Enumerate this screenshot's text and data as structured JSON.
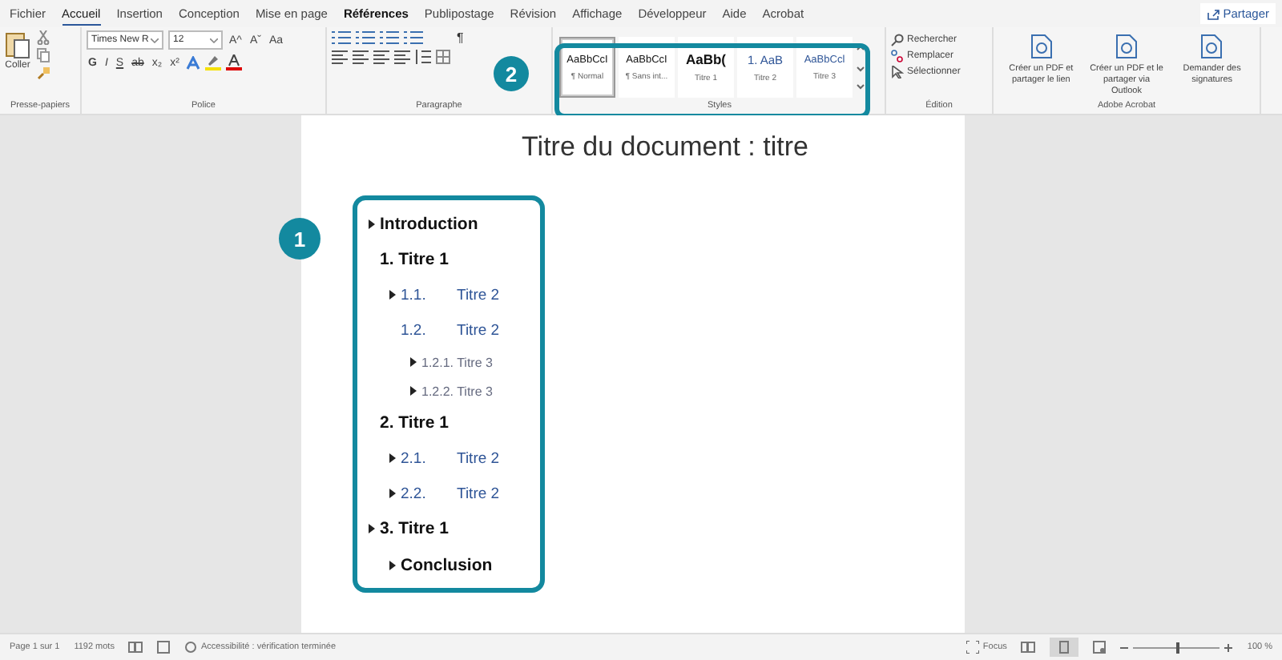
{
  "ribbon_tabs": [
    {
      "label": "Fichier",
      "selected": false,
      "bold": false
    },
    {
      "label": "Accueil",
      "selected": true,
      "bold": false
    },
    {
      "label": "Insertion",
      "selected": false,
      "bold": false
    },
    {
      "label": "Conception",
      "selected": false,
      "bold": false
    },
    {
      "label": "Mise en page",
      "selected": false,
      "bold": false
    },
    {
      "label": "Références",
      "selected": false,
      "bold": true
    },
    {
      "label": "Publipostage",
      "selected": false,
      "bold": false
    },
    {
      "label": "Révision",
      "selected": false,
      "bold": false
    },
    {
      "label": "Affichage",
      "selected": false,
      "bold": false
    },
    {
      "label": "Développeur",
      "selected": false,
      "bold": false
    },
    {
      "label": "Aide",
      "selected": false,
      "bold": false
    },
    {
      "label": "Acrobat",
      "selected": false,
      "bold": false
    }
  ],
  "share_button": "Partager",
  "clipboard": {
    "paste": "Coller",
    "group_label": "Presse-papiers"
  },
  "font": {
    "family": "Times New R",
    "size": "12",
    "grow": "A^",
    "shrink": "Aˇ",
    "case": "Aa",
    "bold": "G",
    "italic": "I",
    "underline": "S",
    "strike": "ab",
    "subscript": "x₂",
    "superscript": "x²",
    "group_label": "Police"
  },
  "paragraph": {
    "group_label": "Paragraphe",
    "pilcrow": "¶"
  },
  "styles": {
    "group_label": "Styles",
    "callout": "2",
    "items": [
      {
        "preview": "AaBbCcI",
        "label": "¶ Normal",
        "kind": "normal",
        "selected": true
      },
      {
        "preview": "AaBbCcI",
        "label": "¶ Sans int...",
        "kind": "plain",
        "selected": false
      },
      {
        "preview": "AaBb(",
        "label": "Titre 1",
        "kind": "h1",
        "selected": false
      },
      {
        "preview": "1. AaB",
        "label": "Titre 2",
        "kind": "h2",
        "selected": false
      },
      {
        "preview": "AaBbCcl",
        "label": "Titre 3",
        "kind": "h3",
        "selected": false
      }
    ]
  },
  "editing": {
    "group_label": "Édition",
    "find": "Rechercher",
    "replace": "Remplacer",
    "select": "Sélectionner"
  },
  "adobe": {
    "group_label": "Adobe Acrobat",
    "actions": [
      "Créer un PDF et partager le lien",
      "Créer un PDF et le partager via Outlook",
      "Demander des signatures"
    ]
  },
  "document": {
    "title": "Titre du document : titre",
    "callout": "1",
    "headings": [
      {
        "kind": "h1",
        "text": "Introduction",
        "arrow": true
      },
      {
        "kind": "h1",
        "number": "1.",
        "text": "Titre 1",
        "arrow": false
      },
      {
        "kind": "h2",
        "number": "1.1.",
        "text": "Titre 2",
        "arrow": true
      },
      {
        "kind": "h2",
        "number": "1.2.",
        "text": "Titre 2",
        "arrow": false
      },
      {
        "kind": "h3",
        "number": "1.2.1.",
        "text": "Titre 3",
        "arrow": true
      },
      {
        "kind": "h3",
        "number": "1.2.2.",
        "text": "Titre 3",
        "arrow": true
      },
      {
        "kind": "h1",
        "number": "2.",
        "text": "Titre 1",
        "arrow": false
      },
      {
        "kind": "h2",
        "number": "2.1.",
        "text": "Titre 2",
        "arrow": true
      },
      {
        "kind": "h2",
        "number": "2.2.",
        "text": "Titre 2",
        "arrow": true
      },
      {
        "kind": "h1",
        "number": "3.",
        "text": "Titre 1",
        "arrow": true
      },
      {
        "kind": "plain",
        "text": "Conclusion",
        "arrow": true
      }
    ]
  },
  "status_bar": {
    "page": "Page 1 sur 1",
    "words": "1192 mots",
    "accessibility": "Accessibilité : vérification terminée",
    "focus": "Focus",
    "zoom": "100 %",
    "zoom_slider": {
      "level": 0.5
    }
  }
}
